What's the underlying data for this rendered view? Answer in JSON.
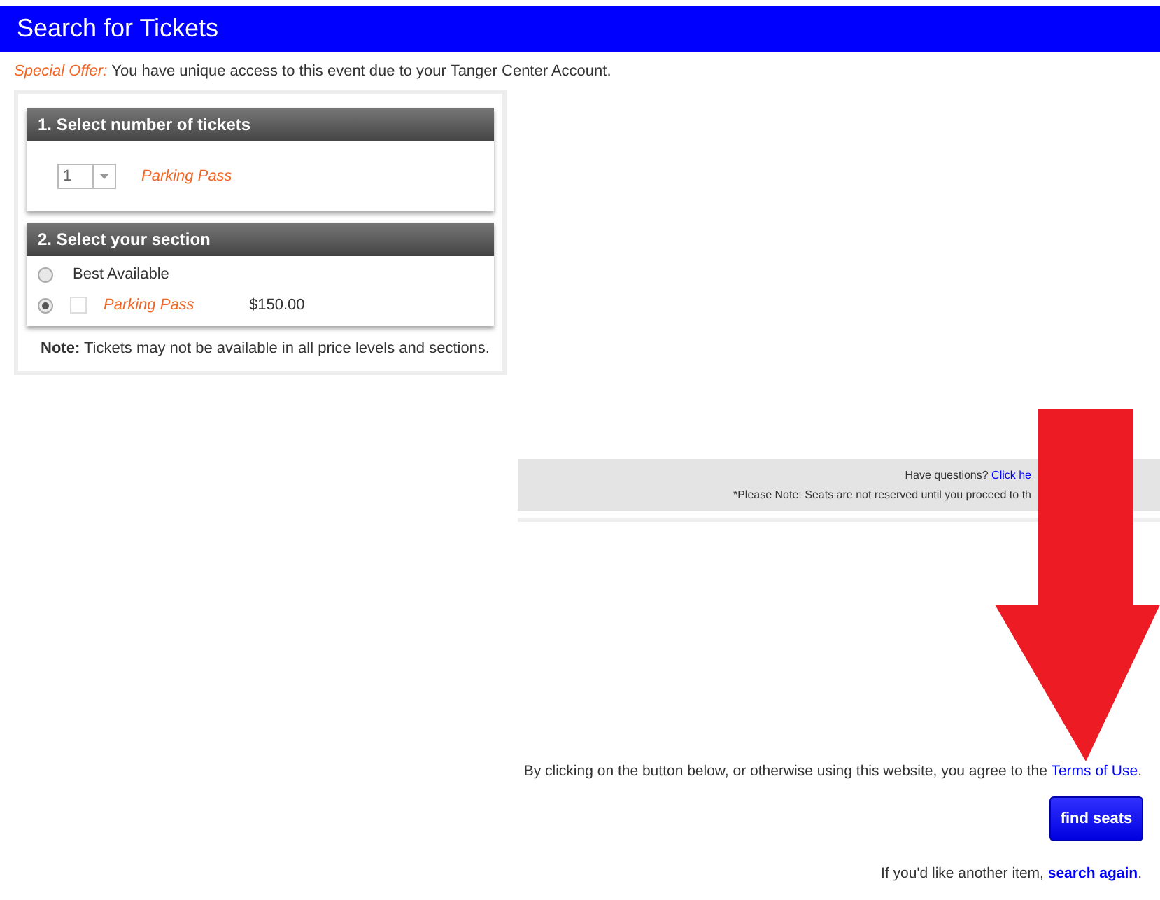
{
  "header": {
    "title": "Search for Tickets"
  },
  "offer": {
    "label": "Special Offer:",
    "text": "You have unique access to this event due to your Tanger Center Account."
  },
  "step1": {
    "title": "1. Select number of tickets",
    "quantity": "1",
    "item": "Parking Pass"
  },
  "step2": {
    "title": "2. Select your section",
    "options": [
      {
        "kind": "plain",
        "label": "Best Available",
        "selected": false
      },
      {
        "kind": "priced",
        "label": "Parking Pass",
        "price": "$150.00",
        "selected": true,
        "checked": false
      }
    ]
  },
  "note": "**Note:** Tickets may not be available in all price levels and sections.",
  "info": {
    "question": "Have questions?",
    "link": "Click he",
    "notice": "*Please Note: Seats are not reserved until you proceed to th"
  },
  "terms": {
    "text": "By clicking on the button below, or otherwise using this website, you agree to the",
    "link": "Terms of Use",
    "suffix": "."
  },
  "button": "find seats",
  "again": {
    "text": "If you'd like another item,",
    "link": "search again",
    "suffix": "."
  }
}
